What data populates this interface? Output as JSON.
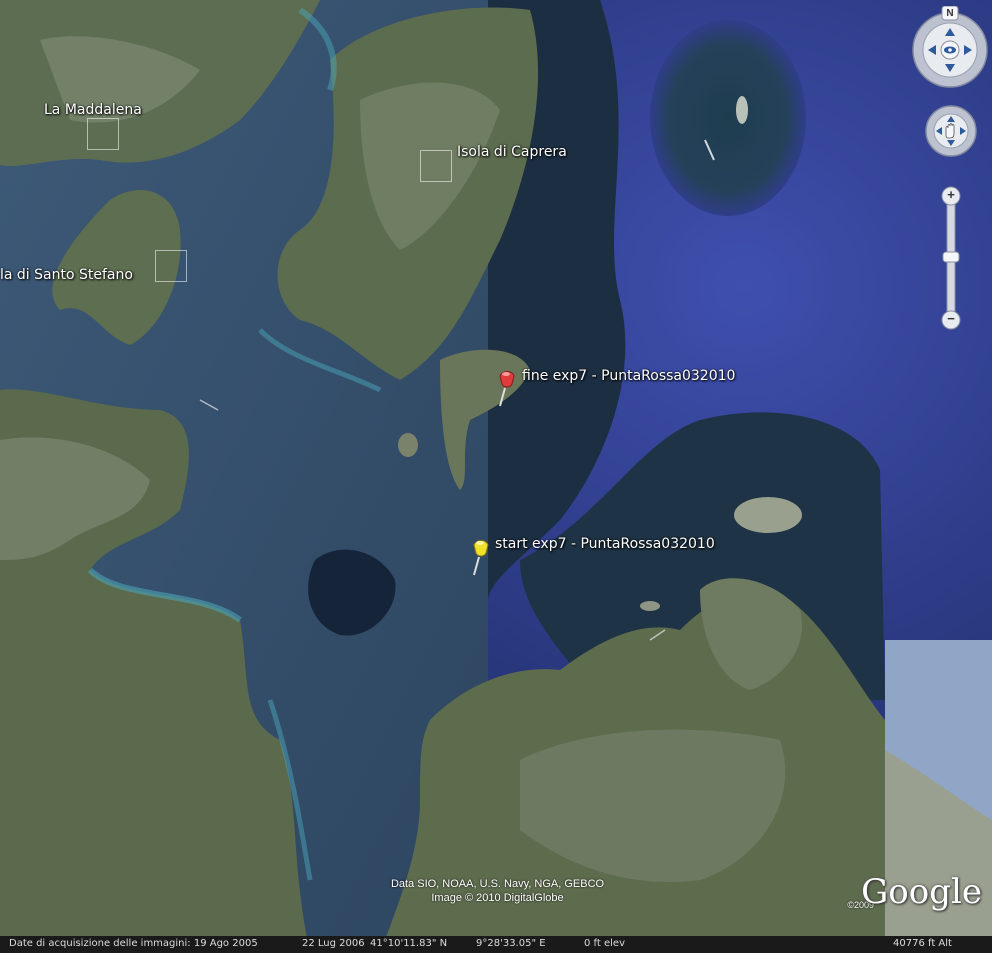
{
  "places": [
    {
      "id": "maddalena",
      "label": "La Maddalena"
    },
    {
      "id": "caprera",
      "label": "Isola di Caprera"
    },
    {
      "id": "santo_stefano",
      "label": "la di Santo Stefano"
    }
  ],
  "placemarks": [
    {
      "id": "fine",
      "label": "fine exp7 - PuntaRossa032010",
      "color": "#e03c3c"
    },
    {
      "id": "start",
      "label": "start exp7 - PuntaRossa032010",
      "color": "#f2e12a"
    }
  ],
  "navigation": {
    "compass_north": "N",
    "zoom_plus": "+",
    "zoom_minus": "−"
  },
  "credits": {
    "line1": "Data SIO, NOAA, U.S. Navy, NGA, GEBCO",
    "line2": "Image © 2010 DigitalGlobe"
  },
  "logo": {
    "text": "Google",
    "year": "©2009"
  },
  "status": {
    "imagery_date": "Date di acquisizione delle immagini: 19 Ago 2005",
    "second_date": "22 Lug 2006",
    "latitude": "41°10'11.83\" N",
    "longitude": "9°28'33.05\" E",
    "elevation": "0 ft elev",
    "eye_altitude": "40776 ft Alt"
  }
}
